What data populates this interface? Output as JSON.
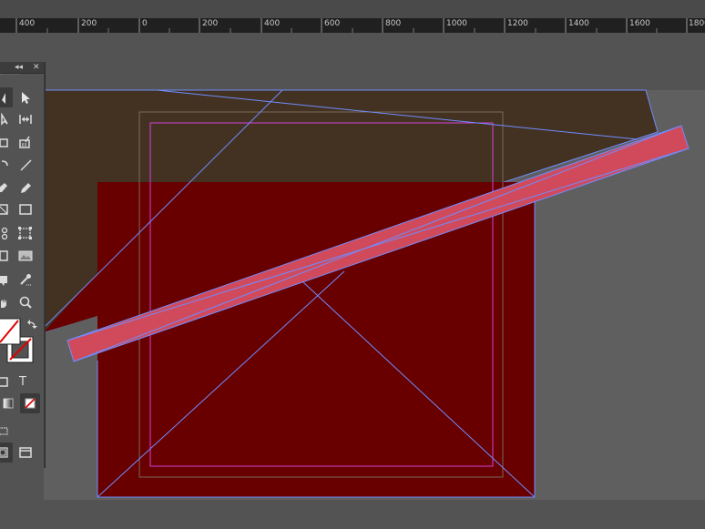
{
  "app": "InDesign",
  "ruler": {
    "labels": [
      "400",
      "200",
      "0",
      "200",
      "400",
      "600",
      "800",
      "1000",
      "1200",
      "1400",
      "1600",
      "1800"
    ]
  },
  "toolbox": {
    "collapse_glyph": "◂◂",
    "close_glyph": "✕",
    "type_tool_glyph": "T",
    "tools": [
      "selection-tool",
      "direct-selection-tool",
      "page-tool",
      "gap-tool",
      "content-collector-tool",
      "content-placer-tool",
      "line-tool",
      "pen-tool",
      "pencil-tool",
      "rectangle-frame-tool",
      "rectangle-tool",
      "scissors-tool",
      "free-transform-tool",
      "gradient-swatch-tool",
      "gradient-feather-tool",
      "note-tool",
      "eyedropper-tool",
      "hand-tool",
      "zoom-tool",
      "fill-stroke-swatches",
      "swap-fill-stroke",
      "format-container",
      "format-text",
      "apply-color",
      "apply-gradient",
      "apply-none",
      "view-mode",
      "screen-mode"
    ]
  },
  "colors": {
    "pasteboard": "#535353",
    "spread_brown": "#433221",
    "page_red": "#680000",
    "bar_pink": "#d14a5c",
    "frame_blue": "#6f8cff",
    "margin_magenta": "#d341d6"
  }
}
